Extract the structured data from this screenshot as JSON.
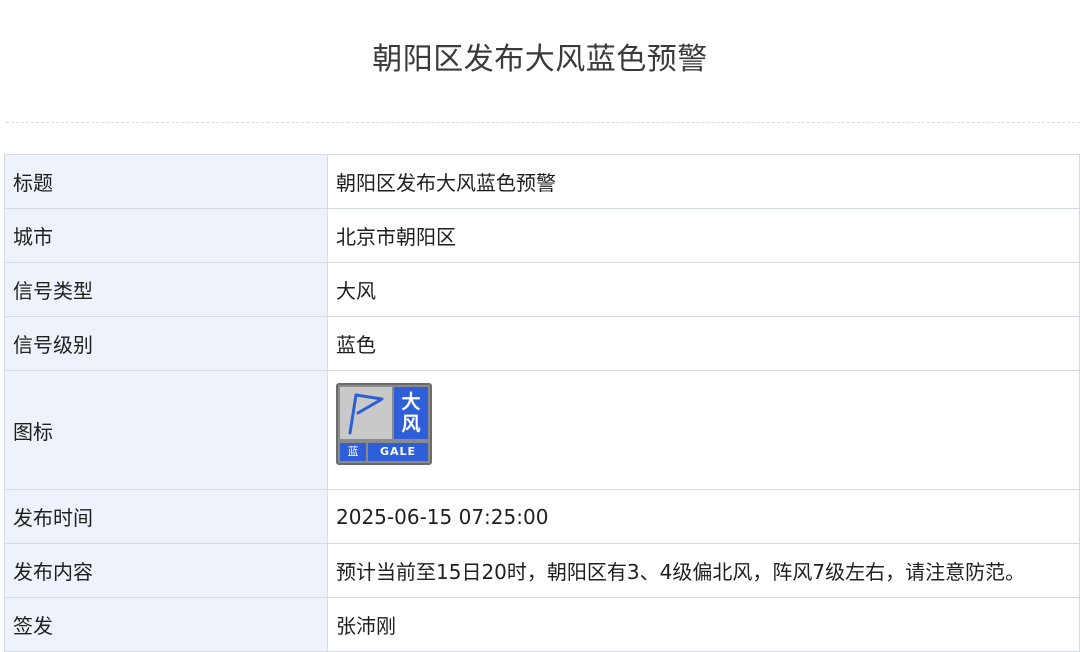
{
  "page": {
    "title": "朝阳区发布大风蓝色预警"
  },
  "rows": [
    {
      "label": "标题",
      "value": "朝阳区发布大风蓝色预警"
    },
    {
      "label": "城市",
      "value": "北京市朝阳区"
    },
    {
      "label": "信号类型",
      "value": "大风"
    },
    {
      "label": "信号级别",
      "value": "蓝色"
    },
    {
      "label": "图标",
      "value": ""
    },
    {
      "label": "发布时间",
      "value": "2025-06-15 07:25:00"
    },
    {
      "label": "发布内容",
      "value": "预计当前至15日20时，朝阳区有3、4级偏北风，阵风7级左右，请注意防范。"
    },
    {
      "label": "签发",
      "value": "张沛刚"
    }
  ],
  "icon": {
    "name": "gale-blue-warning-icon",
    "text_cn_1": "大",
    "text_cn_2": "风",
    "level_text": "蓝",
    "text_en": "GALE",
    "colors": {
      "blue": "#2f5fd8",
      "frame": "#6b6b6b",
      "flag_bg": "#c9c9c9"
    }
  }
}
